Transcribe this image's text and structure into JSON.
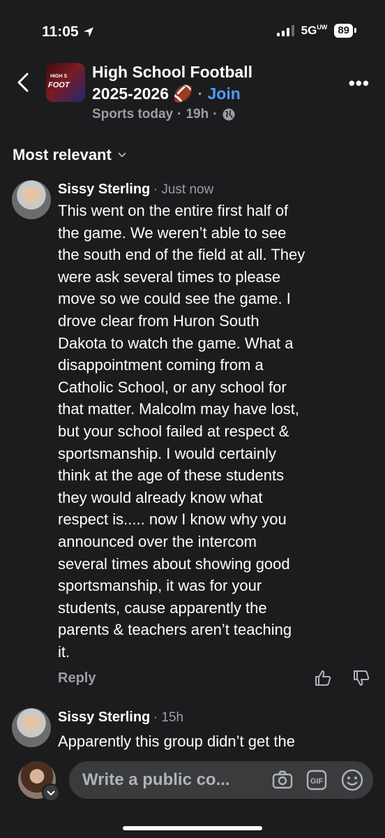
{
  "status_bar": {
    "time": "11:05",
    "network": "5G",
    "network_sub": "UW",
    "battery": "89"
  },
  "header": {
    "group_name_line1": "High School Football",
    "group_name_line2": "2025-2026 🏈",
    "join_label": "Join",
    "separator": "·",
    "source": "Sports today",
    "age": "19h",
    "thumb_text_small": "HIGH S",
    "thumb_text_big": "FOOT"
  },
  "sort": {
    "label": "Most relevant"
  },
  "comments": [
    {
      "author": "Sissy Sterling",
      "time": "· Just now",
      "lines": [
        "This went on the entire first half of",
        "the game. We weren’t able to see",
        "the south end of the field at all. They",
        "were ask several times to please",
        "move so we could see the game. I",
        "drove clear from Huron South",
        "Dakota to watch the game. What a",
        "disappointment coming from a",
        "Catholic School, or any school for",
        "that matter. Malcolm may have lost,",
        "but your school failed at respect &",
        "sportsmanship. I would certainly",
        "think at the age of these students",
        "they would already know what",
        "respect is..... now I know why you",
        "announced over the intercom",
        "several times about showing good",
        "sportsmanship, it was for your",
        "students, cause apparently the",
        "parents & teachers aren’t teaching",
        "it."
      ],
      "reply_label": "Reply"
    },
    {
      "author": "Sissy Sterling",
      "time": "· 15h",
      "lines": [
        "Apparently this group didn’t get the"
      ]
    }
  ],
  "composer": {
    "placeholder": "Write a public co..."
  },
  "colors": {
    "background": "#1c1c1e",
    "accent": "#4d9cf6",
    "muted": "#9a9ea6"
  }
}
